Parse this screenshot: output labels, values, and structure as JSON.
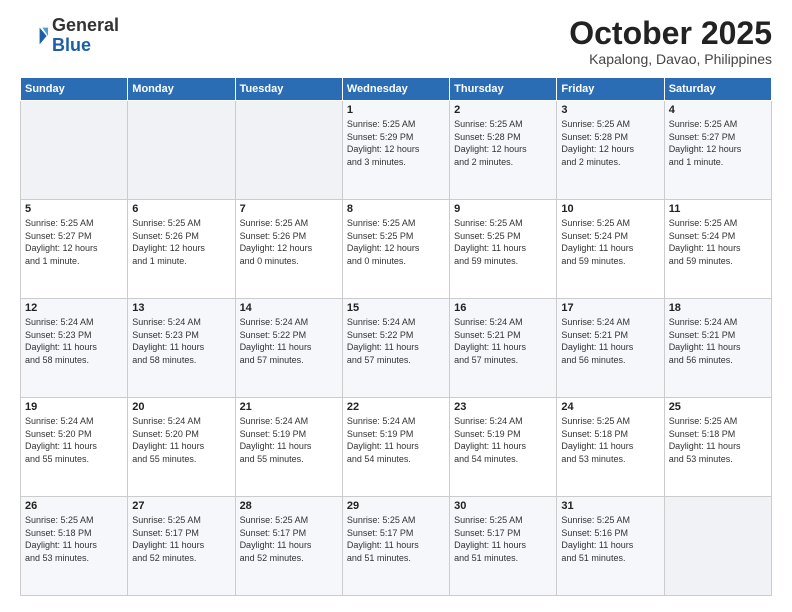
{
  "header": {
    "logo_general": "General",
    "logo_blue": "Blue",
    "month": "October 2025",
    "location": "Kapalong, Davao, Philippines"
  },
  "weekdays": [
    "Sunday",
    "Monday",
    "Tuesday",
    "Wednesday",
    "Thursday",
    "Friday",
    "Saturday"
  ],
  "weeks": [
    [
      {
        "day": "",
        "content": ""
      },
      {
        "day": "",
        "content": ""
      },
      {
        "day": "",
        "content": ""
      },
      {
        "day": "1",
        "content": "Sunrise: 5:25 AM\nSunset: 5:29 PM\nDaylight: 12 hours\nand 3 minutes."
      },
      {
        "day": "2",
        "content": "Sunrise: 5:25 AM\nSunset: 5:28 PM\nDaylight: 12 hours\nand 2 minutes."
      },
      {
        "day": "3",
        "content": "Sunrise: 5:25 AM\nSunset: 5:28 PM\nDaylight: 12 hours\nand 2 minutes."
      },
      {
        "day": "4",
        "content": "Sunrise: 5:25 AM\nSunset: 5:27 PM\nDaylight: 12 hours\nand 1 minute."
      }
    ],
    [
      {
        "day": "5",
        "content": "Sunrise: 5:25 AM\nSunset: 5:27 PM\nDaylight: 12 hours\nand 1 minute."
      },
      {
        "day": "6",
        "content": "Sunrise: 5:25 AM\nSunset: 5:26 PM\nDaylight: 12 hours\nand 1 minute."
      },
      {
        "day": "7",
        "content": "Sunrise: 5:25 AM\nSunset: 5:26 PM\nDaylight: 12 hours\nand 0 minutes."
      },
      {
        "day": "8",
        "content": "Sunrise: 5:25 AM\nSunset: 5:25 PM\nDaylight: 12 hours\nand 0 minutes."
      },
      {
        "day": "9",
        "content": "Sunrise: 5:25 AM\nSunset: 5:25 PM\nDaylight: 11 hours\nand 59 minutes."
      },
      {
        "day": "10",
        "content": "Sunrise: 5:25 AM\nSunset: 5:24 PM\nDaylight: 11 hours\nand 59 minutes."
      },
      {
        "day": "11",
        "content": "Sunrise: 5:25 AM\nSunset: 5:24 PM\nDaylight: 11 hours\nand 59 minutes."
      }
    ],
    [
      {
        "day": "12",
        "content": "Sunrise: 5:24 AM\nSunset: 5:23 PM\nDaylight: 11 hours\nand 58 minutes."
      },
      {
        "day": "13",
        "content": "Sunrise: 5:24 AM\nSunset: 5:23 PM\nDaylight: 11 hours\nand 58 minutes."
      },
      {
        "day": "14",
        "content": "Sunrise: 5:24 AM\nSunset: 5:22 PM\nDaylight: 11 hours\nand 57 minutes."
      },
      {
        "day": "15",
        "content": "Sunrise: 5:24 AM\nSunset: 5:22 PM\nDaylight: 11 hours\nand 57 minutes."
      },
      {
        "day": "16",
        "content": "Sunrise: 5:24 AM\nSunset: 5:21 PM\nDaylight: 11 hours\nand 57 minutes."
      },
      {
        "day": "17",
        "content": "Sunrise: 5:24 AM\nSunset: 5:21 PM\nDaylight: 11 hours\nand 56 minutes."
      },
      {
        "day": "18",
        "content": "Sunrise: 5:24 AM\nSunset: 5:21 PM\nDaylight: 11 hours\nand 56 minutes."
      }
    ],
    [
      {
        "day": "19",
        "content": "Sunrise: 5:24 AM\nSunset: 5:20 PM\nDaylight: 11 hours\nand 55 minutes."
      },
      {
        "day": "20",
        "content": "Sunrise: 5:24 AM\nSunset: 5:20 PM\nDaylight: 11 hours\nand 55 minutes."
      },
      {
        "day": "21",
        "content": "Sunrise: 5:24 AM\nSunset: 5:19 PM\nDaylight: 11 hours\nand 55 minutes."
      },
      {
        "day": "22",
        "content": "Sunrise: 5:24 AM\nSunset: 5:19 PM\nDaylight: 11 hours\nand 54 minutes."
      },
      {
        "day": "23",
        "content": "Sunrise: 5:24 AM\nSunset: 5:19 PM\nDaylight: 11 hours\nand 54 minutes."
      },
      {
        "day": "24",
        "content": "Sunrise: 5:25 AM\nSunset: 5:18 PM\nDaylight: 11 hours\nand 53 minutes."
      },
      {
        "day": "25",
        "content": "Sunrise: 5:25 AM\nSunset: 5:18 PM\nDaylight: 11 hours\nand 53 minutes."
      }
    ],
    [
      {
        "day": "26",
        "content": "Sunrise: 5:25 AM\nSunset: 5:18 PM\nDaylight: 11 hours\nand 53 minutes."
      },
      {
        "day": "27",
        "content": "Sunrise: 5:25 AM\nSunset: 5:17 PM\nDaylight: 11 hours\nand 52 minutes."
      },
      {
        "day": "28",
        "content": "Sunrise: 5:25 AM\nSunset: 5:17 PM\nDaylight: 11 hours\nand 52 minutes."
      },
      {
        "day": "29",
        "content": "Sunrise: 5:25 AM\nSunset: 5:17 PM\nDaylight: 11 hours\nand 51 minutes."
      },
      {
        "day": "30",
        "content": "Sunrise: 5:25 AM\nSunset: 5:17 PM\nDaylight: 11 hours\nand 51 minutes."
      },
      {
        "day": "31",
        "content": "Sunrise: 5:25 AM\nSunset: 5:16 PM\nDaylight: 11 hours\nand 51 minutes."
      },
      {
        "day": "",
        "content": ""
      }
    ]
  ]
}
